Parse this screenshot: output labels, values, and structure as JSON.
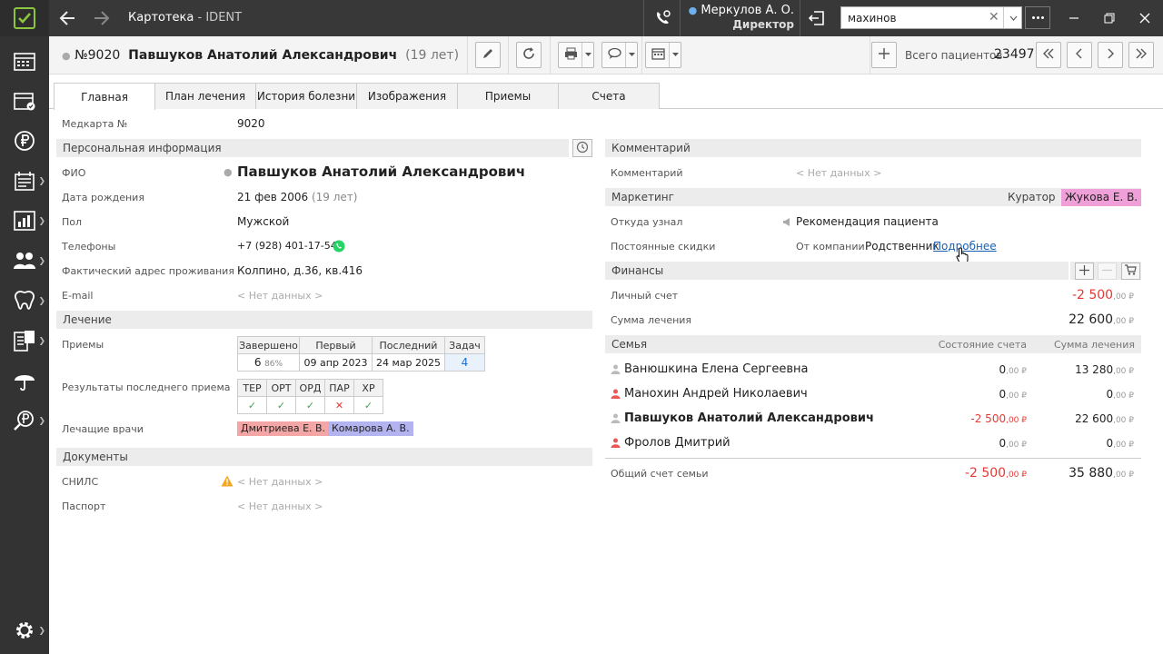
{
  "window": {
    "title_main": "Картотека",
    "title_sep": " - ",
    "title_app": "IDENT"
  },
  "user": {
    "name": "Меркулов А. О.",
    "role": "Директор"
  },
  "search": {
    "value": "махинов"
  },
  "patient": {
    "number": "№9020",
    "name": "Павшуков Анатолий Александрович",
    "age": "(19 лет)"
  },
  "totals": {
    "label": "Всего пациентов",
    "value": "23497"
  },
  "tabs": [
    "Главная",
    "План лечения",
    "История болезни",
    "Изображения",
    "Приемы",
    "Счета"
  ],
  "card": {
    "label": "Медкарта №",
    "value": "9020"
  },
  "personal": {
    "title": "Персональная информация",
    "fio_label": "ФИО",
    "fio": "Павшуков Анатолий Александрович",
    "dob_label": "Дата рождения",
    "dob": "21 фев 2006",
    "dob_age": "(19 лет)",
    "sex_label": "Пол",
    "sex": "Мужской",
    "phone_label": "Телефоны",
    "phone": "+7 (928) 401-17-54",
    "address_label": "Фактический адрес проживания",
    "address": "Колпино, д.36, кв.416",
    "email_label": "E-mail",
    "email": "< Нет данных >"
  },
  "treatment": {
    "title": "Лечение",
    "visits_label": "Приемы",
    "visits_headers": [
      "Завершено",
      "Первый",
      "Последний",
      "Задач"
    ],
    "visits_completed": "6",
    "visits_percent": "86%",
    "visits_first": "09 апр 2023",
    "visits_last": "24 мар 2025",
    "visits_tasks": "4",
    "results_label": "Результаты последнего приема",
    "results_headers": [
      "ТЕР",
      "ОРТ",
      "ОРД",
      "ПАР",
      "ХР"
    ],
    "results_values": [
      "✓",
      "✓",
      "✓",
      "✕",
      "✓"
    ],
    "doctors_label": "Лечащие врачи",
    "doctors": [
      "Дмитриева Е. В.",
      "Комарова А. В."
    ]
  },
  "documents": {
    "title": "Документы",
    "snils_label": "СНИЛС",
    "snils": "< Нет данных >",
    "passport_label": "Паспорт",
    "passport": "< Нет данных >"
  },
  "comment": {
    "title": "Комментарий",
    "label": "Комментарий",
    "value": "< Нет данных >"
  },
  "marketing": {
    "title": "Маркетинг",
    "curator_label": "Куратор",
    "curator": "Жукова Е. В.",
    "source_label": "Откуда узнал",
    "source": "Рекомендация пациента",
    "discount_label": "Постоянные скидки",
    "discount_from": "От компании",
    "discount_value": "Родственник",
    "discount_link": "Подробнее"
  },
  "finance": {
    "title": "Финансы",
    "account_label": "Личный счет",
    "account_int": "-2 500",
    "account_dec": ",00 ₽",
    "sum_label": "Сумма лечения",
    "sum_int": "22 600",
    "sum_dec": ",00 ₽"
  },
  "family": {
    "title": "Семья",
    "col_balance": "Состояние счета",
    "col_sum": "Сумма лечения",
    "members": [
      {
        "name": "Ванюшкина Елена Сергеевна",
        "bal_int": "0",
        "bal_dec": ",00 ₽",
        "sum_int": "13 280",
        "sum_dec": ",00 ₽"
      },
      {
        "name": "Манохин Андрей Николаевич",
        "bal_int": "0",
        "bal_dec": ",00 ₽",
        "sum_int": "0",
        "sum_dec": ",00 ₽"
      },
      {
        "name": "Павшуков Анатолий Александрович",
        "bal_int": "-2 500",
        "bal_dec": ",00 ₽",
        "sum_int": "22 600",
        "sum_dec": ",00 ₽"
      },
      {
        "name": "Фролов Дмитрий",
        "bal_int": "0",
        "bal_dec": ",00 ₽",
        "sum_int": "0",
        "sum_dec": ",00 ₽"
      }
    ],
    "total_label": "Общий счет семьи",
    "total_bal_int": "-2 500",
    "total_bal_dec": ",00 ₽",
    "total_sum_int": "35 880",
    "total_sum_dec": ",00 ₽"
  },
  "colors": {
    "accent": "#8cc63f",
    "negative": "#e53935",
    "doctor1": "#f4a6a6",
    "doctor2": "#b3b3f0",
    "curator": "#f0a0d8",
    "link": "#1a5fb4"
  }
}
